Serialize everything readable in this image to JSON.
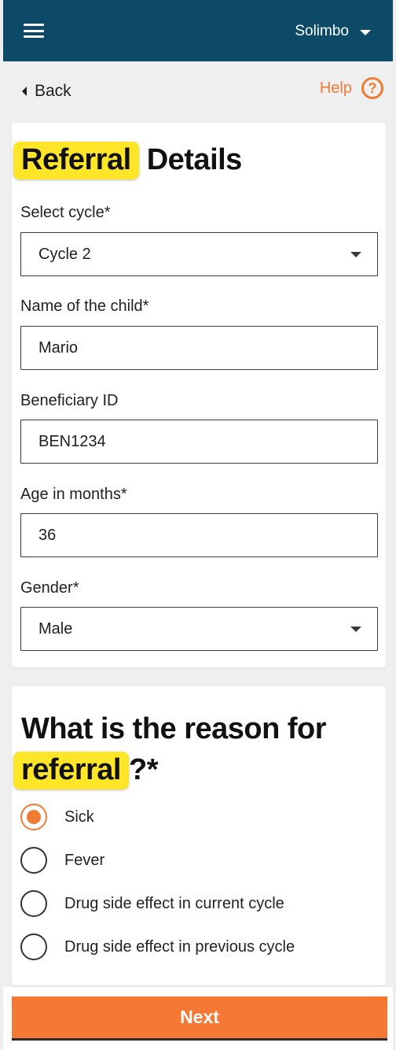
{
  "topbar": {
    "user": "Solimbo"
  },
  "nav": {
    "back": "Back",
    "help": "Help",
    "help_icon": "?"
  },
  "referral": {
    "title_highlight": "Referral",
    "title_rest": " Details",
    "fields": [
      {
        "label": "Select cycle*",
        "value": "Cycle 2",
        "type": "select"
      },
      {
        "label": "Name of the child*",
        "value": "Mario",
        "type": "text"
      },
      {
        "label": "Beneficiary ID",
        "value": "BEN1234",
        "type": "text"
      },
      {
        "label": "Age in months*",
        "value": "36",
        "type": "text"
      },
      {
        "label": "Gender*",
        "value": "Male",
        "type": "select"
      }
    ]
  },
  "reason": {
    "title_line1": "What is the reason for",
    "title_highlight": "referral",
    "title_suffix": "?*",
    "options": [
      {
        "label": "Sick",
        "checked": true
      },
      {
        "label": "Fever",
        "checked": false
      },
      {
        "label": "Drug side effect in current cycle",
        "checked": false
      },
      {
        "label": "Drug side effect in previous cycle",
        "checked": false
      }
    ]
  },
  "footer": {
    "next": "Next"
  },
  "colors": {
    "header": "#0c4a67",
    "accent": "#f57935",
    "highlight": "#fde628"
  }
}
